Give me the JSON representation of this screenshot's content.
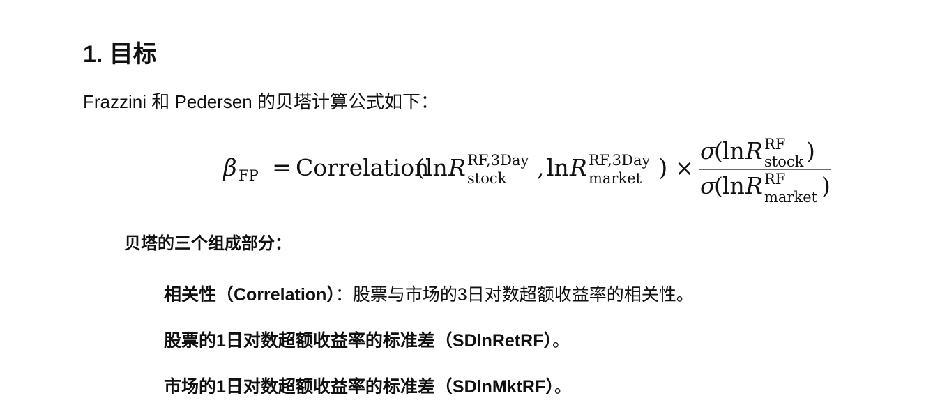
{
  "document": {
    "heading": "1. 目标",
    "intro": "Frazzini 和 Pedersen 的贝塔计算公式如下：",
    "formula": {
      "beta_symbol": "β",
      "beta_subscript": "FP",
      "equals": "=",
      "correlation_word": "Correlation",
      "ln": "ln",
      "r_symbol": "R",
      "superscript_3day": "RF,3Day",
      "superscript_rf": "RF",
      "subscript_stock": "stock",
      "subscript_market": "market",
      "times": "×",
      "sigma": "σ"
    },
    "components_heading": "贝塔的三个组成部分：",
    "components": [
      {
        "bold_text": "相关性（Correlation）",
        "normal_text": "：股票与市场的3日对数超额收益率的相关性。"
      },
      {
        "bold_text": "股票的1日对数超额收益率的标准差（SDlnRetRF）",
        "normal_text": "。"
      },
      {
        "bold_text": "市场的1日对数超额收益率的标准差（SDlnMktRF）",
        "normal_text": "。"
      }
    ]
  }
}
